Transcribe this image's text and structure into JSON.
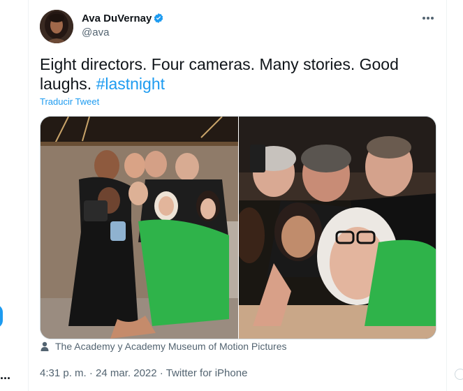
{
  "tweet": {
    "author": {
      "name": "Ava DuVernay",
      "handle": "@ava",
      "verified": true
    },
    "text_main": "Eight directors. Four cameras. Many stories. Good laughs. ",
    "hashtag": "#lastnight",
    "translate_label": "Traducir Tweet",
    "media": {
      "tag": "The Academy y Academy Museum of Motion Pictures"
    },
    "meta": {
      "time": "4:31 p. m.",
      "separator": "·",
      "date": "24 mar. 2022",
      "source": "Twitter for iPhone"
    }
  },
  "rail": {
    "more_label": "..."
  },
  "colors": {
    "accent": "#1d9bf0",
    "text": "#0f1419",
    "muted": "#536471",
    "sweater_green": "#2fb34a"
  }
}
